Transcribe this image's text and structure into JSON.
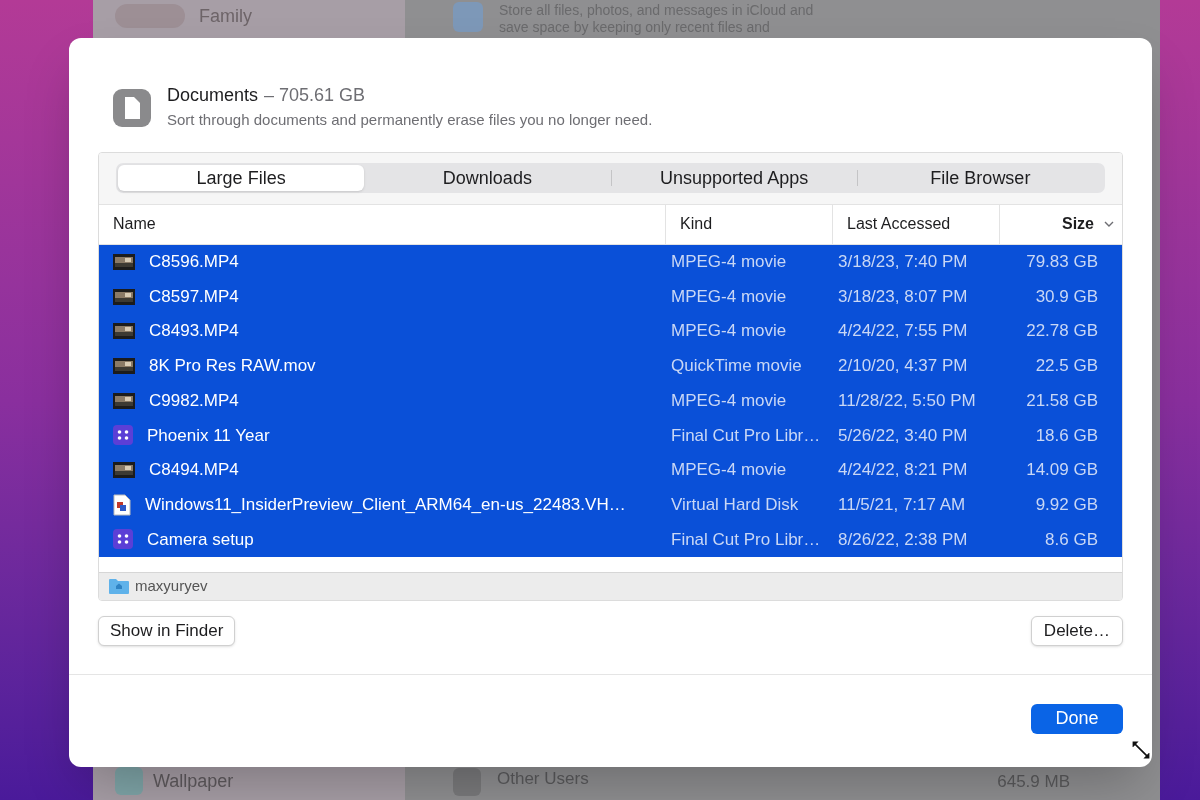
{
  "background": {
    "family_label": "Family",
    "icloud_description": "Store all files, photos, and messages in iCloud and",
    "icloud_description_2": "save space by keeping only recent files and",
    "wallpaper_label": "Wallpaper",
    "other_users_label": "Other Users",
    "other_users_size": "645.9 MB"
  },
  "dialog": {
    "title": "Documents",
    "title_size": "– 705.61 GB",
    "subtitle": "Sort through documents and permanently erase files you no longer need.",
    "tabs": [
      {
        "label": "Large Files",
        "selected": true
      },
      {
        "label": "Downloads",
        "selected": false
      },
      {
        "label": "Unsupported Apps",
        "selected": false
      },
      {
        "label": "File Browser",
        "selected": false
      }
    ],
    "columns": [
      {
        "label": "Name",
        "sorted": false
      },
      {
        "label": "Kind",
        "sorted": false
      },
      {
        "label": "Last Accessed",
        "sorted": false
      },
      {
        "label": "Size",
        "sorted": true
      }
    ],
    "rows": [
      {
        "kind": "video",
        "name": "C8596.MP4",
        "type": "MPEG-4 movie",
        "last_accessed": "3/18/23, 7:40 PM",
        "size": "79.83 GB",
        "selected": true
      },
      {
        "kind": "video",
        "name": "C8597.MP4",
        "type": "MPEG-4 movie",
        "last_accessed": "3/18/23, 8:07 PM",
        "size": "30.9 GB",
        "selected": true
      },
      {
        "kind": "video",
        "name": "C8493.MP4",
        "type": "MPEG-4 movie",
        "last_accessed": "4/24/22, 7:55 PM",
        "size": "22.78 GB",
        "selected": true
      },
      {
        "kind": "video",
        "name": "8K Pro Res RAW.mov",
        "type": "QuickTime movie",
        "last_accessed": "2/10/20, 4:37 PM",
        "size": "22.5 GB",
        "selected": true
      },
      {
        "kind": "video",
        "name": "C9982.MP4",
        "type": "MPEG-4 movie",
        "last_accessed": "11/28/22, 5:50 PM",
        "size": "21.58 GB",
        "selected": true
      },
      {
        "kind": "library",
        "name": "Phoenix 11 Year",
        "type": "Final Cut Pro Libr…",
        "last_accessed": "5/26/22, 3:40 PM",
        "size": "18.6 GB",
        "selected": true
      },
      {
        "kind": "video",
        "name": "C8494.MP4",
        "type": "MPEG-4 movie",
        "last_accessed": "4/24/22, 8:21 PM",
        "size": "14.09 GB",
        "selected": true
      },
      {
        "kind": "disk",
        "name": "Windows11_InsiderPreview_Client_ARM64_en-us_22483.VH…",
        "type": "Virtual Hard Disk",
        "last_accessed": "11/5/21, 7:17 AM",
        "size": "9.92 GB",
        "selected": true
      },
      {
        "kind": "library",
        "name": "Camera setup",
        "type": "Final Cut Pro Libr…",
        "last_accessed": "8/26/22, 2:38 PM",
        "size": "8.6 GB",
        "selected": true
      }
    ],
    "path": "maxyuryev",
    "show_in_finder_button": "Show in Finder",
    "delete_button": "Delete…",
    "done_button": "Done"
  }
}
